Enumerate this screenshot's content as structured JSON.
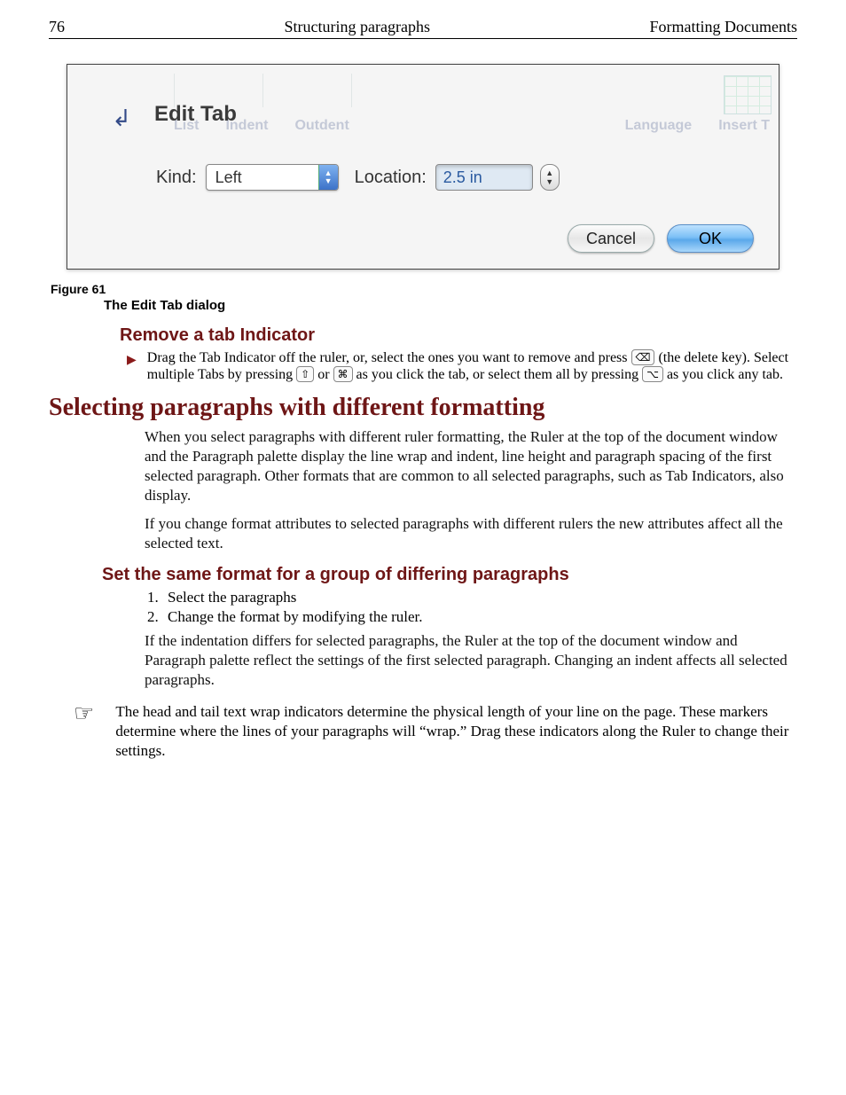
{
  "header": {
    "page_number": "76",
    "center": "Structuring paragraphs",
    "right": "Formatting Documents"
  },
  "dialog": {
    "title": "Edit Tab",
    "kind_label": "Kind:",
    "kind_value": "Left",
    "location_label": "Location:",
    "location_value": "2.5 in",
    "cancel": "Cancel",
    "ok": "OK",
    "ghost": {
      "a": "List",
      "b": "Indent",
      "c": "Outdent",
      "d": "Language",
      "e": "Insert T"
    }
  },
  "figure": {
    "label": "Figure 61",
    "caption": "The Edit Tab dialog"
  },
  "h_remove": "Remove a tab Indicator",
  "remove_text_a": "Drag the Tab Indicator off the ruler, or, select the ones you want to remove and press ",
  "remove_text_b": " (the delete key). Select multiple Tabs by pressing ",
  "remove_text_c": " or ",
  "remove_text_d": " as you click the tab, or select them all by pressing ",
  "remove_text_e": " as you click any tab.",
  "key_delete": "⌫",
  "key_shift": "⇧",
  "key_cmd": "⌘",
  "key_opt": "⌥",
  "h_selecting": "Selecting paragraphs with different formatting",
  "sel_p1": "When you select paragraphs with different ruler formatting, the Ruler at the top of the document window and the Paragraph palette display the line wrap and indent, line height and paragraph spacing of the first selected paragraph. Other formats that are common to all selected paragraphs, such as Tab Indicators, also display.",
  "sel_p2": "If you change format attributes to selected paragraphs with different rulers the new attributes affect all the selected text.",
  "h_setsame": "Set the same format for a group of differing paragraphs",
  "step1": "Select the paragraphs",
  "step2": "Change the format by modifying the ruler.",
  "setsame_p": "If the indentation differs for selected paragraphs, the Ruler at the top of the document window and Paragraph palette reflect the settings of the first selected paragraph. Changing an indent affects all selected paragraphs.",
  "note": "The head and tail text wrap indicators determine the physical length of your line on the page. These markers determine where the lines of your paragraphs will “wrap.” Drag these indicators along the Ruler to change their settings."
}
